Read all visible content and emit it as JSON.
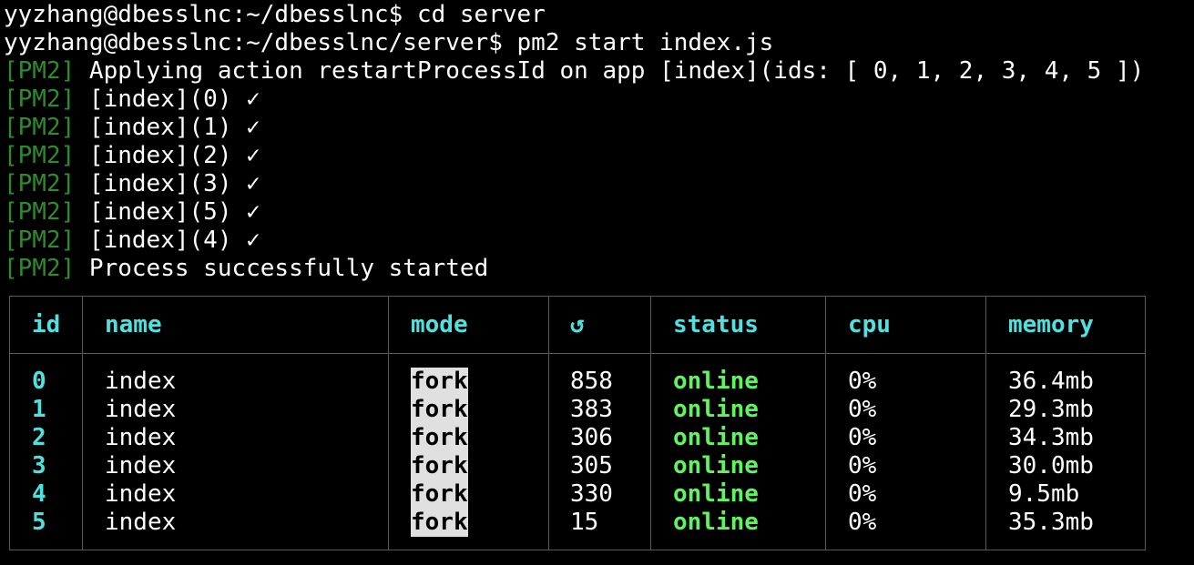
{
  "commands": {
    "line1": "yyzhang@dbesslnc:~/dbesslnc$ cd server",
    "line2": "yyzhang@dbesslnc:~/dbesslnc/server$ pm2 start index.js"
  },
  "pm2_log": {
    "tag": "[PM2]",
    "messages": [
      " Applying action restartProcessId on app [index](ids: [ 0, 1, 2, 3, 4, 5 ])",
      " [index](0) ✓",
      " [index](1) ✓",
      " [index](2) ✓",
      " [index](3) ✓",
      " [index](5) ✓",
      " [index](4) ✓",
      " Process successfully started"
    ]
  },
  "table": {
    "headers": {
      "id": "id",
      "name": "name",
      "mode": "mode",
      "restarts": "↺",
      "status": "status",
      "cpu": "cpu",
      "memory": "memory"
    },
    "rows": [
      {
        "id": "0",
        "name": "index",
        "mode": "fork",
        "restarts": "858",
        "status": "online",
        "cpu": "0%",
        "memory": "36.4mb"
      },
      {
        "id": "1",
        "name": "index",
        "mode": "fork",
        "restarts": "383",
        "status": "online",
        "cpu": "0%",
        "memory": "29.3mb"
      },
      {
        "id": "2",
        "name": "index",
        "mode": "fork",
        "restarts": "306",
        "status": "online",
        "cpu": "0%",
        "memory": "34.3mb"
      },
      {
        "id": "3",
        "name": "index",
        "mode": "fork",
        "restarts": "305",
        "status": "online",
        "cpu": "0%",
        "memory": "30.0mb"
      },
      {
        "id": "4",
        "name": "index",
        "mode": "fork",
        "restarts": "330",
        "status": "online",
        "cpu": "0%",
        "memory": "9.5mb"
      },
      {
        "id": "5",
        "name": "index",
        "mode": "fork",
        "restarts": "15",
        "status": "online",
        "cpu": "0%",
        "memory": "35.3mb"
      }
    ]
  },
  "colors": {
    "background": "#000000",
    "pm2_tag": "#2e8b2e",
    "header_cyan": "#4fe0e0",
    "status_green": "#5ff55f",
    "mode_highlight": "#e0e0e0"
  },
  "icons": {
    "restarts_header": "reload-icon"
  }
}
